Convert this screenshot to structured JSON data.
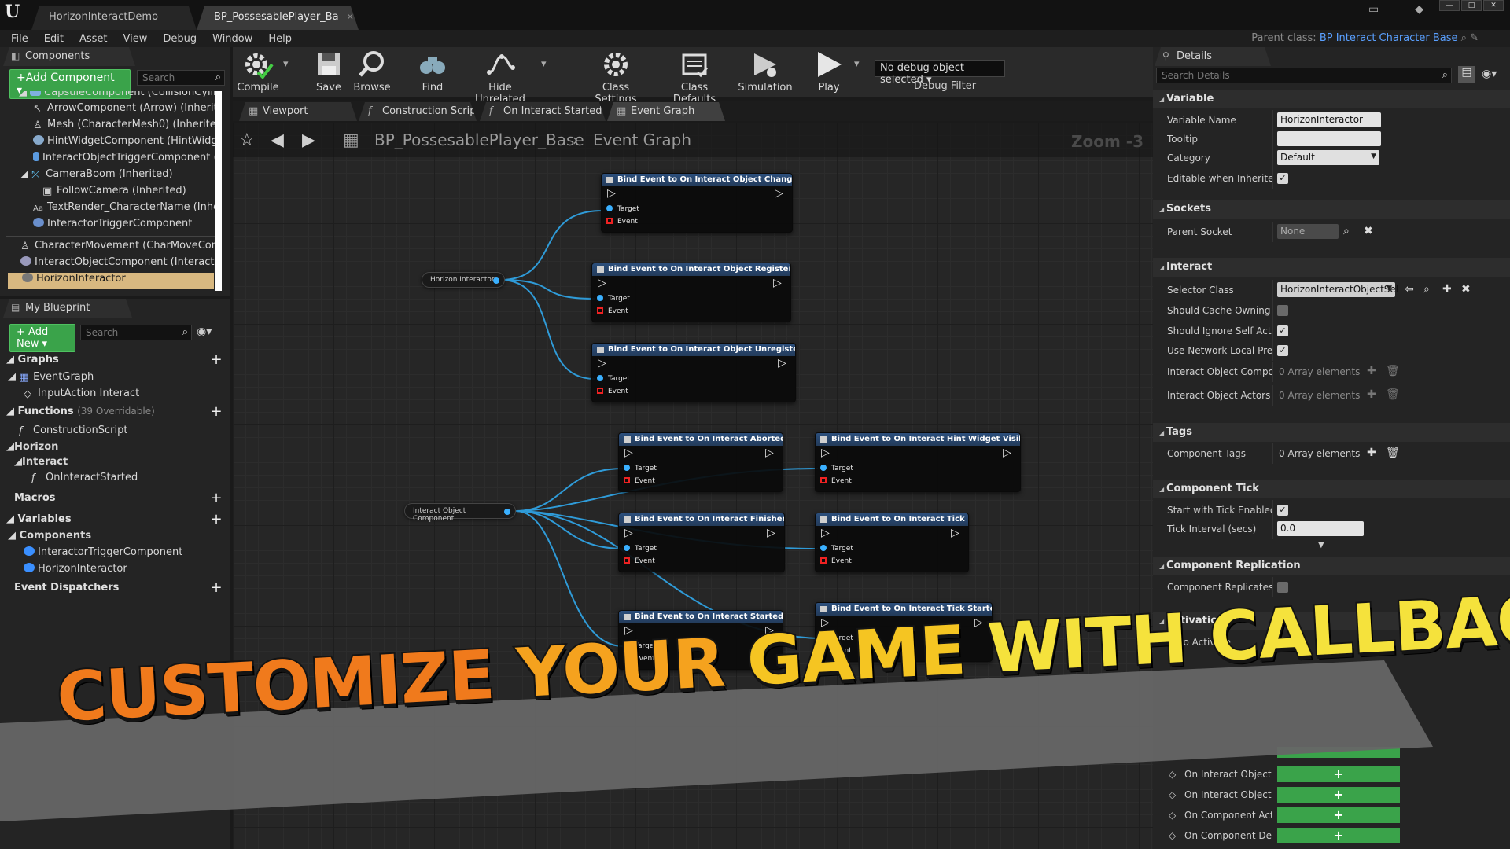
{
  "titlebar": {
    "tabs": [
      {
        "label": "HorizonInteractDemo"
      },
      {
        "label": "BP_PossesablePlayer_Ba"
      }
    ]
  },
  "menu": [
    "File",
    "Edit",
    "Asset",
    "View",
    "Debug",
    "Window",
    "Help"
  ],
  "parent_class": {
    "label": "Parent class:",
    "value": "BP Interact Character Base"
  },
  "components_panel": {
    "tab": "Components",
    "add_button": "+Add Component",
    "search_placeholder": "Search",
    "items": [
      {
        "label": "CapsuleComponent (CollisionCylinder)"
      },
      {
        "label": "ArrowComponent (Arrow) (Inherited)"
      },
      {
        "label": "Mesh (CharacterMesh0) (Inherited)"
      },
      {
        "label": "HintWidgetComponent (HintWidgetCo"
      },
      {
        "label": "InteractObjectTriggerComponent (Int"
      },
      {
        "label": "CameraBoom (Inherited)"
      },
      {
        "label": "FollowCamera (Inherited)"
      },
      {
        "label": "TextRender_CharacterName (Inherite"
      },
      {
        "label": "InteractorTriggerComponent"
      },
      {
        "label": "CharacterMovement (CharMoveComp)"
      },
      {
        "label": "InteractObjectComponent (InteractObje"
      },
      {
        "label": "HorizonInteractor"
      }
    ]
  },
  "my_blueprint": {
    "tab": "My Blueprint",
    "add_button": "+ Add New",
    "search_placeholder": "Search",
    "graphs_header": "Graphs",
    "event_graph": "EventGraph",
    "input_action": "InputAction Interact",
    "functions_header": "Functions",
    "functions_count": "(39 Overridable)",
    "construction_script": "ConstructionScript",
    "horizon": "Horizon",
    "interact": "Interact",
    "on_interact_started": "OnInteractStarted",
    "macros_header": "Macros",
    "variables_header": "Variables",
    "components_header": "Components",
    "var_interactor_trigger": "InteractorTriggerComponent",
    "var_horizon_interactor": "HorizonInteractor",
    "event_dispatchers_header": "Event Dispatchers"
  },
  "toolbar": {
    "compile": "Compile",
    "save": "Save",
    "browse": "Browse",
    "find": "Find",
    "hide_unrelated": "Hide Unrelated",
    "class_settings": "Class Settings",
    "class_defaults": "Class Defaults",
    "simulation": "Simulation",
    "play": "Play",
    "debug_select": "No debug object selected",
    "debug_filter": "Debug Filter"
  },
  "graph_tabs": [
    "Viewport",
    "Construction Scrip",
    "On Interact Started",
    "Event Graph"
  ],
  "graph": {
    "breadcrumb_blueprint": "BP_PossesablePlayer_Base",
    "breadcrumb_graph": "Event Graph",
    "zoom": "Zoom -3",
    "var_horizon_interactor": "Horizon Interactor",
    "var_interact_object_component": "Interact Object Component",
    "pin_target": "Target",
    "pin_event": "Event",
    "nodes": [
      {
        "title": "Bind Event to On Interact Object Changed Event"
      },
      {
        "title": "Bind Event to On Interact Object Registered Event"
      },
      {
        "title": "Bind Event to On Interact Object Unregistered Event"
      },
      {
        "title": "Bind Event to On Interact Aborted Event"
      },
      {
        "title": "Bind Event to On Interact Hint Widget Visibility Event"
      },
      {
        "title": "Bind Event to On Interact Finished Event"
      },
      {
        "title": "Bind Event to On Interact Tick Event"
      },
      {
        "title": "Bind Event to On Interact Started Event"
      },
      {
        "title": "Bind Event to On Interact Tick Started Event"
      }
    ]
  },
  "details": {
    "tab": "Details",
    "search_placeholder": "Search Details",
    "variable_header": "Variable",
    "variable_name_label": "Variable Name",
    "variable_name_value": "HorizonInteractor",
    "tooltip_label": "Tooltip",
    "category_label": "Category",
    "category_value": "Default",
    "editable_label": "Editable when Inherited",
    "sockets_header": "Sockets",
    "parent_socket_label": "Parent Socket",
    "parent_socket_value": "None",
    "interact_header": "Interact",
    "selector_class_label": "Selector Class",
    "selector_class_value": "HorizonInteractObjectSel",
    "cache_label": "Should Cache Owning Cor",
    "ignore_self_label": "Should Ignore Self Actor",
    "network_label": "Use Network Local Predit",
    "io_components_label": "Interact Object Componer",
    "io_actors_label": "Interact Object Actors",
    "array_elements": "0 Array elements",
    "tags_header": "Tags",
    "component_tags_label": "Component Tags",
    "tick_header": "Component Tick",
    "start_tick_label": "Start with Tick Enabled",
    "tick_interval_label": "Tick Interval (secs)",
    "tick_interval_value": "0.0",
    "replication_header": "Component Replication",
    "replicates_label": "Component Replicates",
    "activation_header": "Activation",
    "auto_activate_label": "Auto Activate",
    "events": [
      {
        "label": "On Interact Object Re"
      },
      {
        "label": "On Interact Object Ur"
      },
      {
        "label": "On Component Activ"
      },
      {
        "label": "On Component Deact"
      }
    ]
  },
  "banner": {
    "w1": "CUSTOMIZE",
    "w2": "YOUR",
    "w3": "GAME",
    "w4": "WITH",
    "w5": "CALLBACKS"
  }
}
